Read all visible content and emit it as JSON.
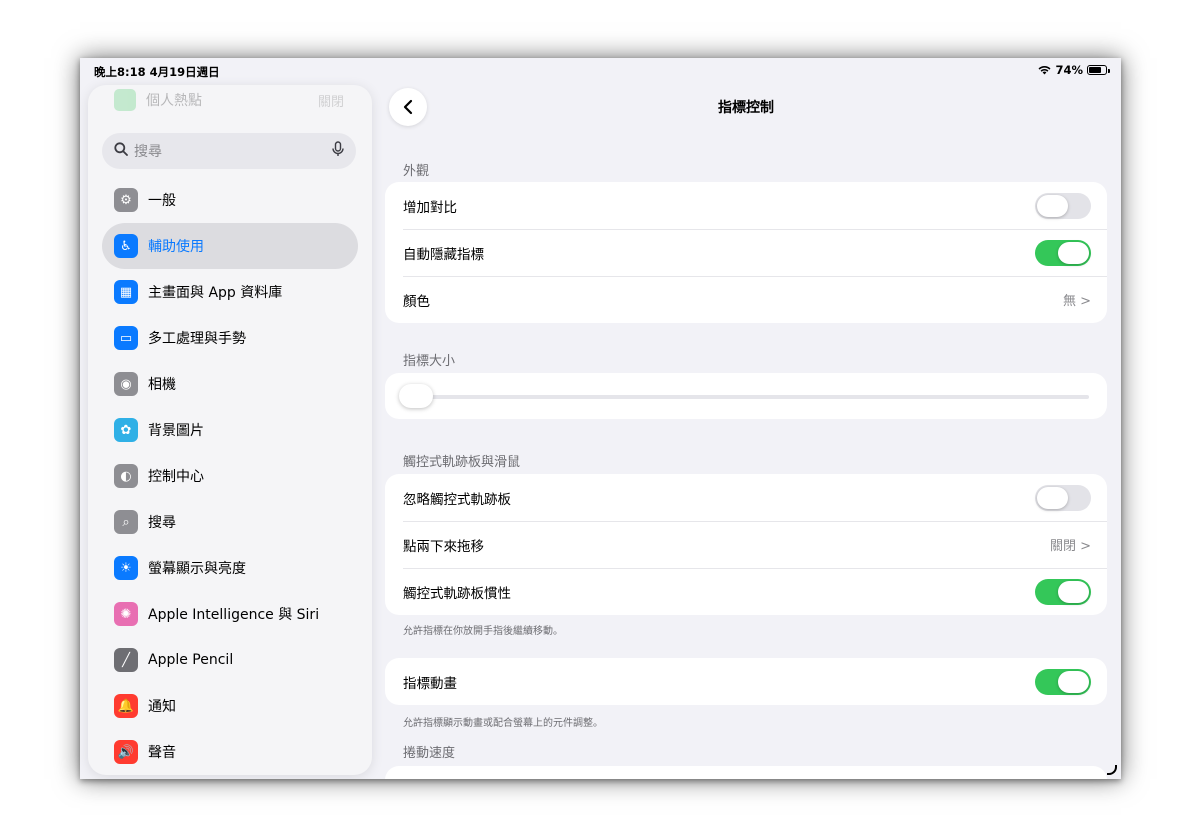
{
  "status": {
    "time": "晚上8:18  4月19日週日",
    "battery": "74%",
    "battery_level": 0.74
  },
  "sidebar": {
    "faded_item": {
      "label": "個人熱點",
      "value": "關閉"
    },
    "search_placeholder": "搜尋",
    "items": [
      {
        "label": "一般",
        "icon": "gear-icon",
        "color": "#8e8e93",
        "glyph": "⚙"
      },
      {
        "label": "輔助使用",
        "icon": "accessibility-icon",
        "color": "#0a7aff",
        "glyph": "♿",
        "active": true
      },
      {
        "label": "主畫面與 App 資料庫",
        "icon": "home-screen-icon",
        "color": "#0a7aff",
        "glyph": "▦"
      },
      {
        "label": "多工處理與手勢",
        "icon": "multitasking-icon",
        "color": "#0a7aff",
        "glyph": "▭"
      },
      {
        "label": "相機",
        "icon": "camera-icon",
        "color": "#8e8e93",
        "glyph": "◉"
      },
      {
        "label": "背景圖片",
        "icon": "wallpaper-icon",
        "color": "#2fb0e6",
        "glyph": "✿"
      },
      {
        "label": "控制中心",
        "icon": "control-center-icon",
        "color": "#8e8e93",
        "glyph": "◐"
      },
      {
        "label": "搜尋",
        "icon": "search-icon",
        "color": "#8e8e93",
        "glyph": "⌕"
      },
      {
        "label": "螢幕顯示與亮度",
        "icon": "brightness-icon",
        "color": "#0a7aff",
        "glyph": "☀"
      },
      {
        "label": "Apple Intelligence 與 Siri",
        "icon": "siri-icon",
        "color": "#e86fb2",
        "glyph": "✺"
      },
      {
        "label": "Apple Pencil",
        "icon": "pencil-icon",
        "color": "#6e6e73",
        "glyph": "╱"
      },
      {
        "label": "通知",
        "icon": "notification-icon",
        "color": "#ff3b30",
        "glyph": "🔔"
      },
      {
        "label": "聲音",
        "icon": "sound-icon",
        "color": "#ff3b30",
        "glyph": "🔊"
      }
    ]
  },
  "main": {
    "title": "指標控制",
    "appearance": {
      "header": "外觀",
      "rows": [
        {
          "label": "增加對比",
          "toggle": false
        },
        {
          "label": "自動隱藏指標",
          "toggle": true
        },
        {
          "label": "顏色",
          "value": "無 >"
        }
      ]
    },
    "pointer_size": {
      "header": "指標大小",
      "value": 0.0
    },
    "trackpad": {
      "header": "觸控式軌跡板與滑鼠",
      "rows": [
        {
          "label": "忽略觸控式軌跡板",
          "toggle": false
        },
        {
          "label": "點兩下來拖移",
          "value": "關閉 >"
        },
        {
          "label": "觸控式軌跡板慣性",
          "toggle": true
        }
      ],
      "footnote": "允許指標在你放開手指後繼續移動。"
    },
    "animation": {
      "rows": [
        {
          "label": "指標動畫",
          "toggle": true
        }
      ],
      "footnote": "允許指標顯示動畫或配合螢幕上的元件調整。"
    },
    "scroll_speed": {
      "header": "捲動速度"
    }
  },
  "colors": {
    "accent": "#0a7aff",
    "toggle_on": "#34c759"
  }
}
